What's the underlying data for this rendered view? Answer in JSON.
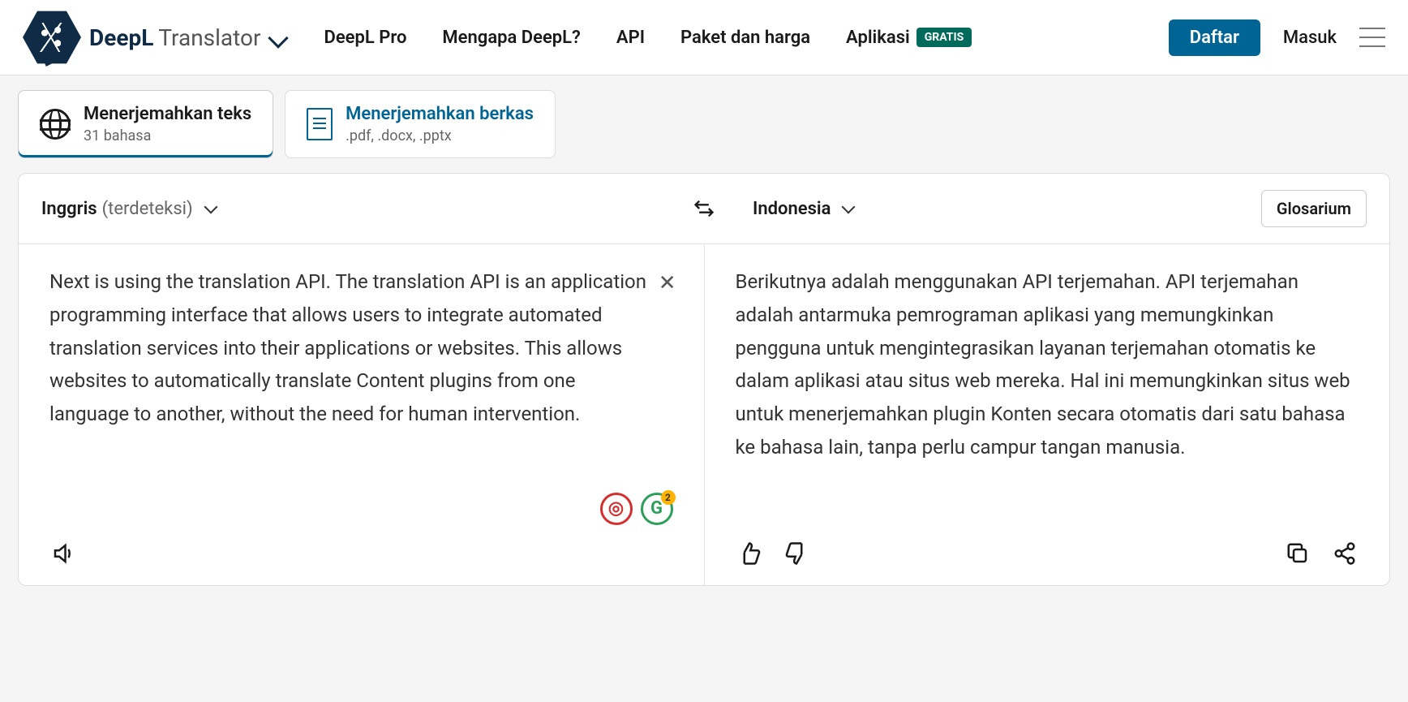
{
  "brand": {
    "bold": "DeepL",
    "light": "Translator"
  },
  "nav": {
    "pro": "DeepL Pro",
    "why": "Mengapa DeepL?",
    "api": "API",
    "plans": "Paket dan harga",
    "apps": "Aplikasi",
    "free_badge": "GRATIS"
  },
  "auth": {
    "signup": "Daftar",
    "login": "Masuk"
  },
  "tabs": {
    "text": {
      "title": "Menerjemahkan teks",
      "sub": "31 bahasa"
    },
    "file": {
      "title": "Menerjemahkan berkas",
      "sub": ".pdf, .docx, .pptx"
    }
  },
  "lang": {
    "src": "Inggris",
    "src_hint": "(terdeteksi)",
    "dst": "Indonesia",
    "glossary": "Glosarium"
  },
  "source_text": "Next is using the translation API. The translation API is an application programming interface that allows users to integrate automated translation services into their applications or websites. This allows websites to automatically translate Content plugins from one language to another, without the need for human intervention.",
  "target_text": "Berikutnya adalah menggunakan API terjemahan. API terjemahan adalah antarmuka pemrograman aplikasi yang memungkinkan pengguna untuk mengintegrasikan layanan terjemahan otomatis ke dalam aplikasi atau situs web mereka. Hal ini memungkinkan situs web untuk menerjemahkan plugin Konten secara otomatis dari satu bahasa ke bahasa lain, tanpa perlu campur tangan manusia.",
  "float": {
    "badge_count": "2"
  }
}
